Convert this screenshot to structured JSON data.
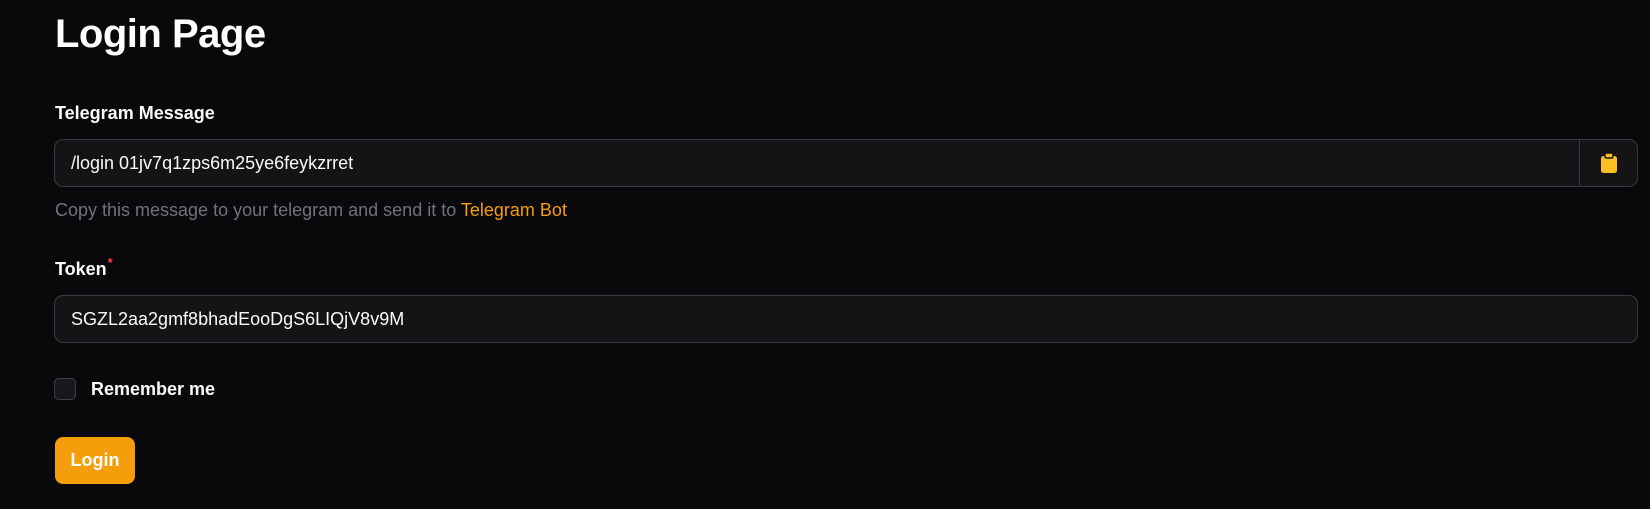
{
  "page": {
    "title": "Login Page"
  },
  "telegram_message": {
    "label": "Telegram Message",
    "value": "/login 01jv7q1zps6m25ye6feykzrret",
    "copy_icon": "clipboard-icon",
    "hint_text": "Copy this message to your telegram and send it to ",
    "hint_link": "Telegram Bot"
  },
  "token": {
    "label": "Token",
    "required_mark": "*",
    "value": "SGZL2aa2gmf8bhadEooDgS6LIQjV8v9M"
  },
  "remember_me": {
    "label": "Remember me",
    "checked": false
  },
  "login_button": {
    "label": "Login"
  },
  "colors": {
    "background": "#09090b",
    "accent": "#f59e0b",
    "required": "#ef4444",
    "muted_text": "#71717a"
  }
}
